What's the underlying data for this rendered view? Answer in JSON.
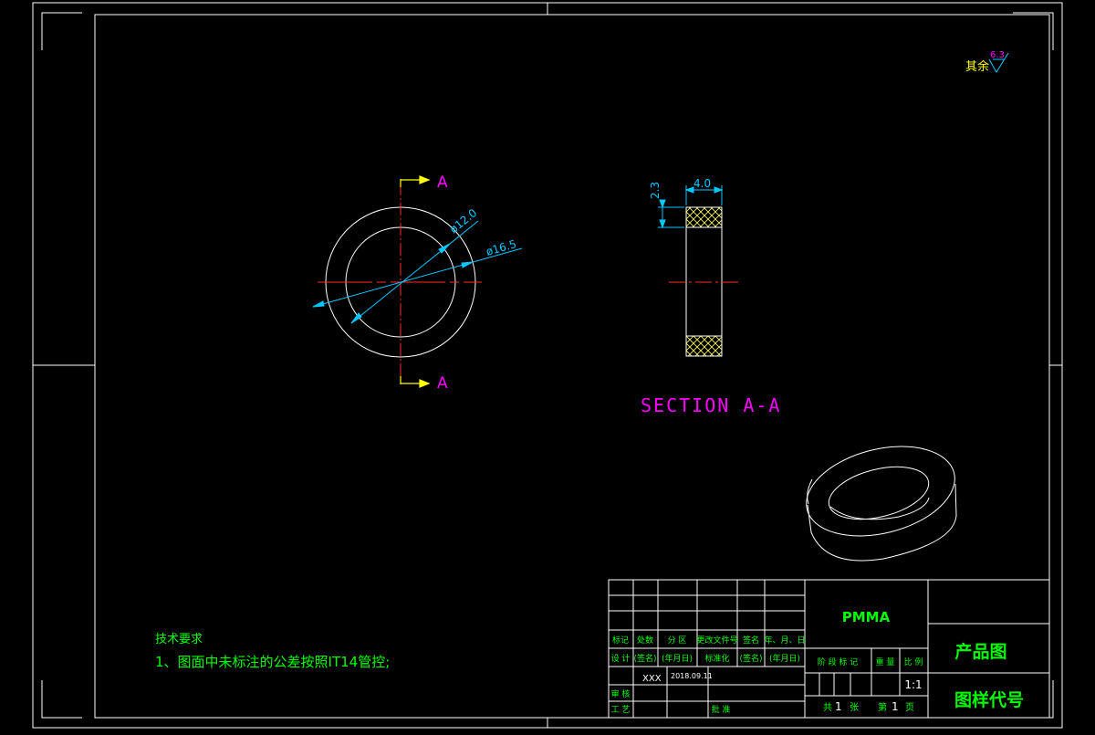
{
  "colors": {
    "background": "#000000",
    "frame": "#ffffff",
    "cyan": "#00c8ff",
    "red_center": "#ff2a2a",
    "yellow": "#ffff00",
    "magenta": "#ff00ff",
    "green": "#00ff00",
    "hatch": "#ffff66"
  },
  "surface_finish": {
    "label": "其余",
    "value": "6.3"
  },
  "front_view": {
    "section_mark_top": "A",
    "section_mark_bottom": "A",
    "dim_inner": "ø12.0",
    "dim_outer": "ø16.5"
  },
  "section_view": {
    "dim_width": "4.0",
    "dim_height": "2.3",
    "title": "SECTION A-A"
  },
  "tech_requirements": {
    "title": "技术要求",
    "item_1": "1、图面中未标注的公差按照IT14管控;"
  },
  "title_block": {
    "material": "PMMA",
    "name": "产品图",
    "drawing_code": "图样代号",
    "hdr_mark": "标记",
    "hdr_count": "处数",
    "hdr_zone": "分 区",
    "hdr_change_doc": "更改文件号",
    "hdr_sign": "签名",
    "hdr_date": "年、月、日",
    "row_design": "设 计",
    "sign_1": "(签名)",
    "date_1": "(年月日)",
    "standardization": "标准化",
    "sign_2": "(签名)",
    "date_2": "(年月日)",
    "stage_mark": "阶 段 标 记",
    "weight": "重 量",
    "scale_label": "比 例",
    "designer": "XXX",
    "design_date": "2018.09.11",
    "scale": "1:1",
    "row_review": "审 核",
    "row_process": "工 艺",
    "approve": "批 准",
    "sheets_total_pre": "共",
    "sheets_total": "1",
    "sheets_total_post": "张",
    "sheet_no_pre": "第",
    "sheet_no": "1",
    "sheet_no_post": "页"
  }
}
